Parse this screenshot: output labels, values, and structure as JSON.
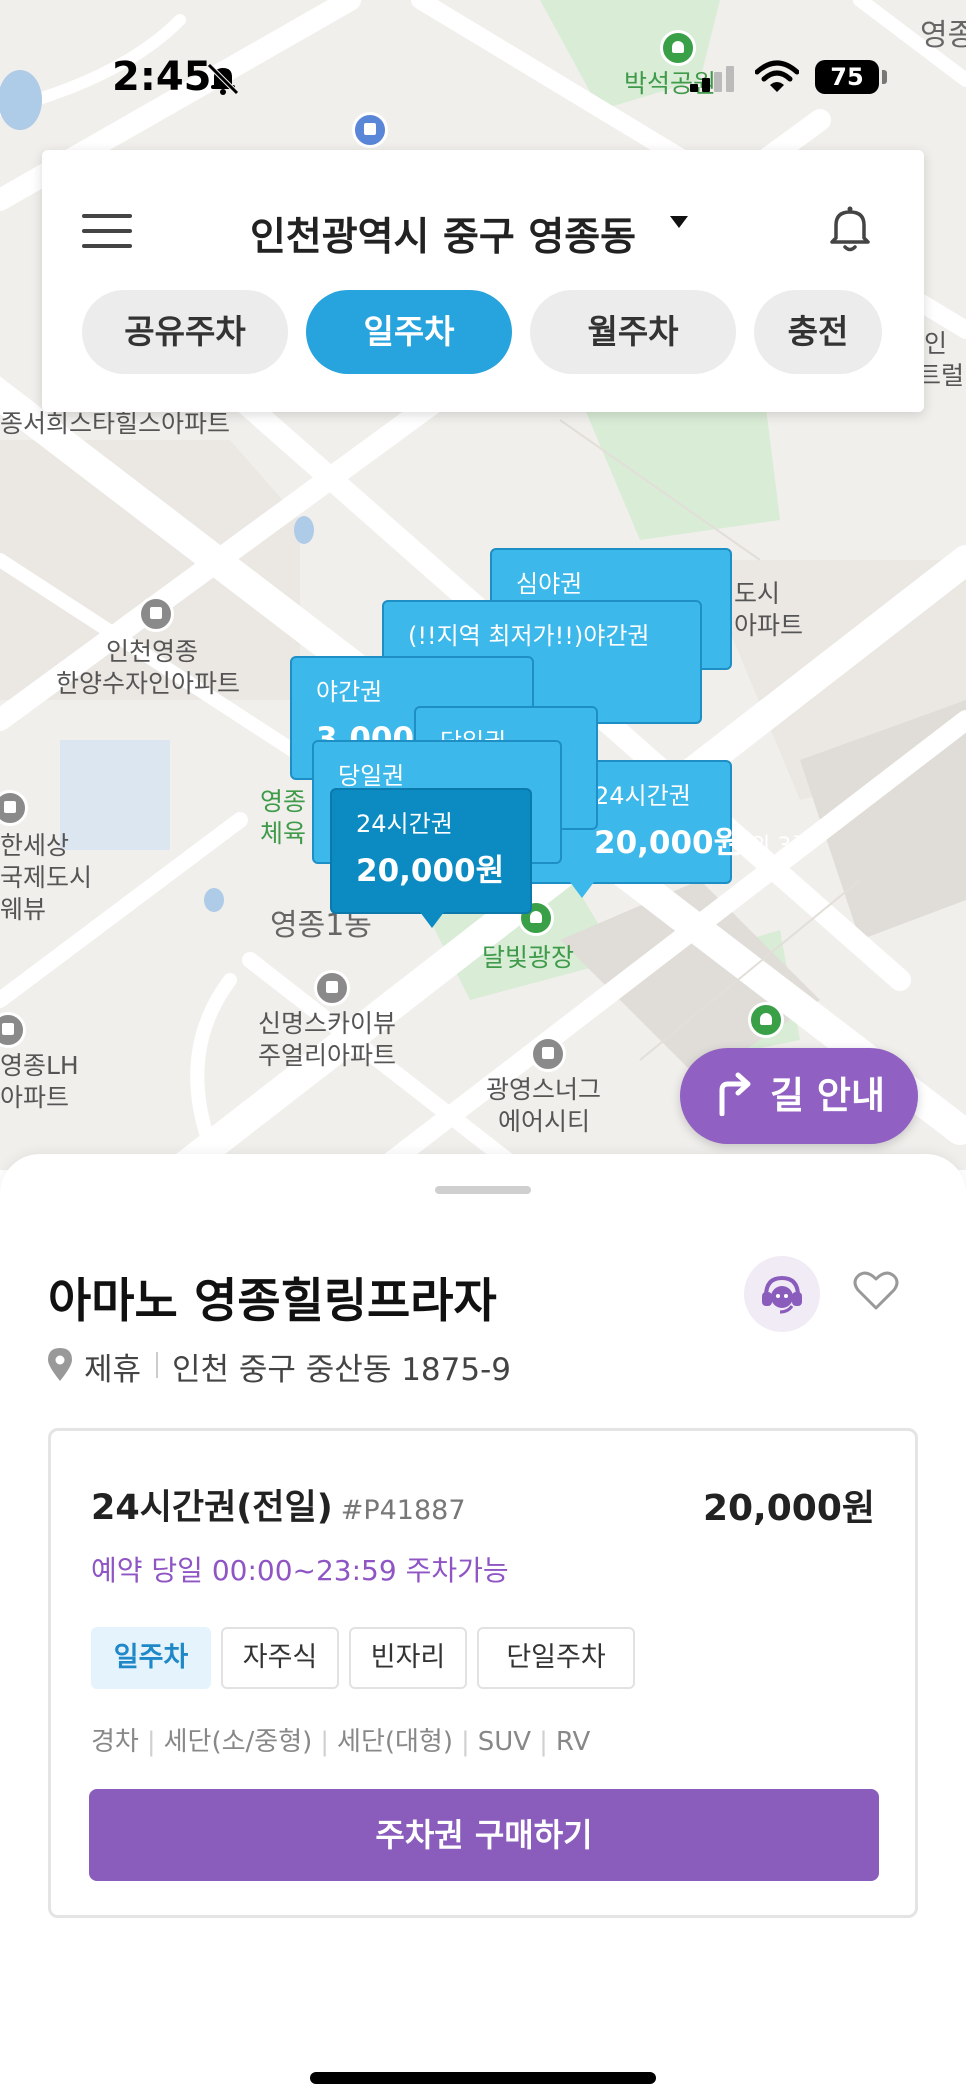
{
  "status_bar": {
    "time": "2:45",
    "battery": "75"
  },
  "header": {
    "location": "인천광역시 중구 영종동",
    "tabs": [
      {
        "label": "공유주차",
        "active": false
      },
      {
        "label": "일주차",
        "active": true
      },
      {
        "label": "월주차",
        "active": false
      },
      {
        "label": "충전",
        "active": false
      }
    ]
  },
  "map": {
    "labels": {
      "park_top": "박석공원",
      "corner_top_right": "영종",
      "apt_left": "종서희스타힐스아파트",
      "apt_mid_1": "인천영종",
      "apt_mid_2": "한양수자인아파트",
      "apt_right_1": "도시",
      "apt_right_2": "아파트",
      "sports_1": "영종",
      "sports_2": "체육",
      "left_edge_1": "한세상",
      "left_edge_2": "국제도시",
      "left_edge_3": "웨뷰",
      "district": "영종1동",
      "plaza": "달빛광장",
      "apt_bottom_1": "신명스카이뷰",
      "apt_bottom_2": "주얼리아파트",
      "lh_1": "영종LH",
      "lh_2": "아파트",
      "mall_1": "광영스너그",
      "mall_2": "에어시티",
      "right_edge_1": "인",
      "right_edge_2": "트럴"
    },
    "markers": {
      "night_late": "심야권",
      "cheapest": "(!!지역 최저가!!)야간권",
      "night": "야간권",
      "night_price": "3,000원",
      "day_back": "당일권",
      "day": "당일권",
      "h24_back": "24시간권",
      "h24_back_price": "20,000원",
      "h24_back_extra": "외 3종",
      "selected_name": "24시간권",
      "selected_price": "20,000원"
    },
    "nav_button": "길 안내"
  },
  "detail": {
    "name": "아마노 영종힐링프라자",
    "tag": "제휴",
    "address": "인천 중구 중산동 1875-9",
    "ticket": {
      "name": "24시간권(전일)",
      "code": "#P41887",
      "price": "20,000원",
      "availability": "예약 당일 00:00~23:59 주차가능",
      "tags": [
        "일주차",
        "자주식",
        "빈자리",
        "단일주차"
      ],
      "vehicles": [
        "경차",
        "세단(소/중형)",
        "세단(대형)",
        "SUV",
        "RV"
      ],
      "buy_label": "주차권 구매하기"
    }
  },
  "colors": {
    "accent_blue": "#27a3dd",
    "marker_blue": "#3db8ea",
    "purple": "#8a5dbd",
    "map_bg": "#f1efec"
  }
}
